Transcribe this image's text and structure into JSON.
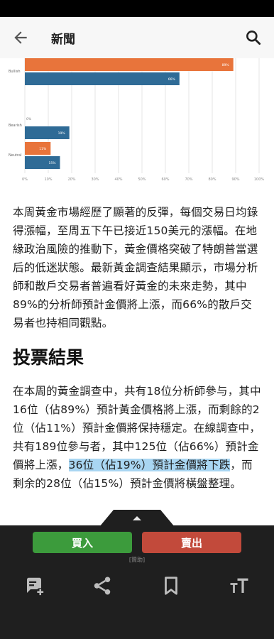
{
  "header": {
    "title": "新聞",
    "back_icon": "back-arrow-icon",
    "search_icon": "search-icon"
  },
  "chart_data": {
    "type": "bar",
    "orientation": "horizontal",
    "categories": [
      "Bullish",
      "Bearish",
      "Neutral"
    ],
    "series": [
      {
        "color": "#e8743b",
        "values": [
          89,
          0,
          11
        ],
        "labels": [
          "89%",
          "0%",
          "11%"
        ]
      },
      {
        "color": "#2f6b96",
        "values": [
          66,
          19,
          15
        ],
        "labels": [
          "66%",
          "19%",
          "15%"
        ]
      }
    ],
    "x_ticks": [
      "0%",
      "10%",
      "20%",
      "30%",
      "40%",
      "50%",
      "60%",
      "70%",
      "80%",
      "90%",
      "100%"
    ],
    "xlim": [
      0,
      100
    ],
    "grid": true
  },
  "article": {
    "para1": "本周黃金市場經歷了顯著的反彈，每個交易日均錄得漲幅，至周五下午已接近150美元的漲幅。在地緣政治風險的推動下，黃金價格突破了特朗普當選后的低迷狀態。最新黃金調查結果顯示，市場分析師和散戶交易者普遍看好黃金的未來走勢，其中89%的分析師預計金價將上漲，而66%的散戶交易者也持相同觀點。",
    "heading": "投票結果",
    "para2_a": "在本周的黃金調查中，共有18位分析師參与，其中16位（佔89%）預計黃金價格將上漲，而剩餘的2位（佔11%）預計金價將保持穩定。在線調查中，共有189位參与者，其中125位（佔66%）預計金價將上漲，",
    "para2_hl": "36位（佔19%）預計金價將下跌",
    "para2_b": "，而剩余的28位（佔15%）預計金價將橫盤整理。"
  },
  "bottom_bar": {
    "buy_label": "買入",
    "sell_label": "賣出",
    "ad_label": "[贊助]",
    "tools": [
      "comment-add-icon",
      "share-icon",
      "bookmark-icon",
      "font-size-icon"
    ]
  }
}
